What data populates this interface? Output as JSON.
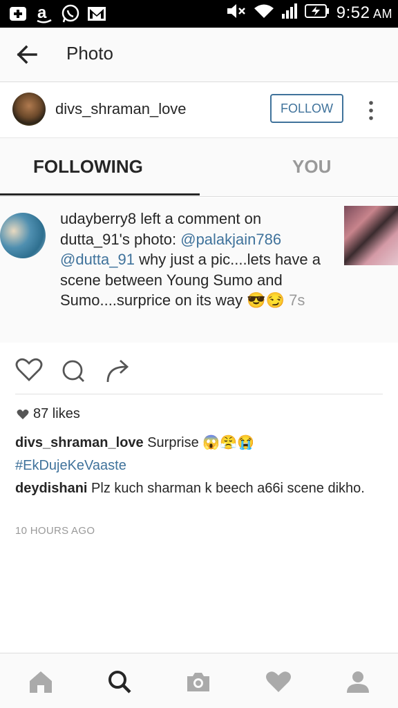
{
  "status_bar": {
    "time": "9:52",
    "ampm": "AM",
    "left_icons": [
      "add-box-icon",
      "amazon-icon",
      "whatsapp-icon",
      "gmail-icon"
    ],
    "right_icons": [
      "mute-icon",
      "wifi-icon",
      "signal-icon",
      "battery-charging-icon"
    ]
  },
  "header": {
    "title": "Photo",
    "back_icon": "arrow-left-icon"
  },
  "post_author": {
    "username": "divs_shraman_love",
    "follow_label": "FOLLOW"
  },
  "activity_tabs": {
    "following": "FOLLOWING",
    "you": "YOU"
  },
  "notification": {
    "actor": "udayberry8",
    "action": " left a comment on ",
    "target_user": "dutta_91",
    "target_suffix": "'s photo: ",
    "mention1": "@palakjain786",
    "mention2": "@dutta_91",
    "comment": " why just a pic....lets have a scene between Young Sumo and Sumo....surprice on its way ",
    "emojis": "😎😏",
    "time": "7s"
  },
  "post": {
    "likes": "87 likes",
    "caption_user": "divs_shraman_love",
    "caption_text": "Surprise",
    "caption_emojis": "😱😤😭",
    "hashtag": "#EkDujeKeVaaste",
    "comment_user": "deydishani",
    "comment_text": "Plz kuch sharman k beech a66i scene dikho.",
    "posted_ago": "10 HOURS AGO"
  },
  "bottom_nav": [
    "home-icon",
    "search-icon",
    "camera-icon",
    "heart-icon",
    "profile-icon"
  ],
  "colors": {
    "link": "#3f729b",
    "muted": "#999999",
    "text": "#262626"
  }
}
